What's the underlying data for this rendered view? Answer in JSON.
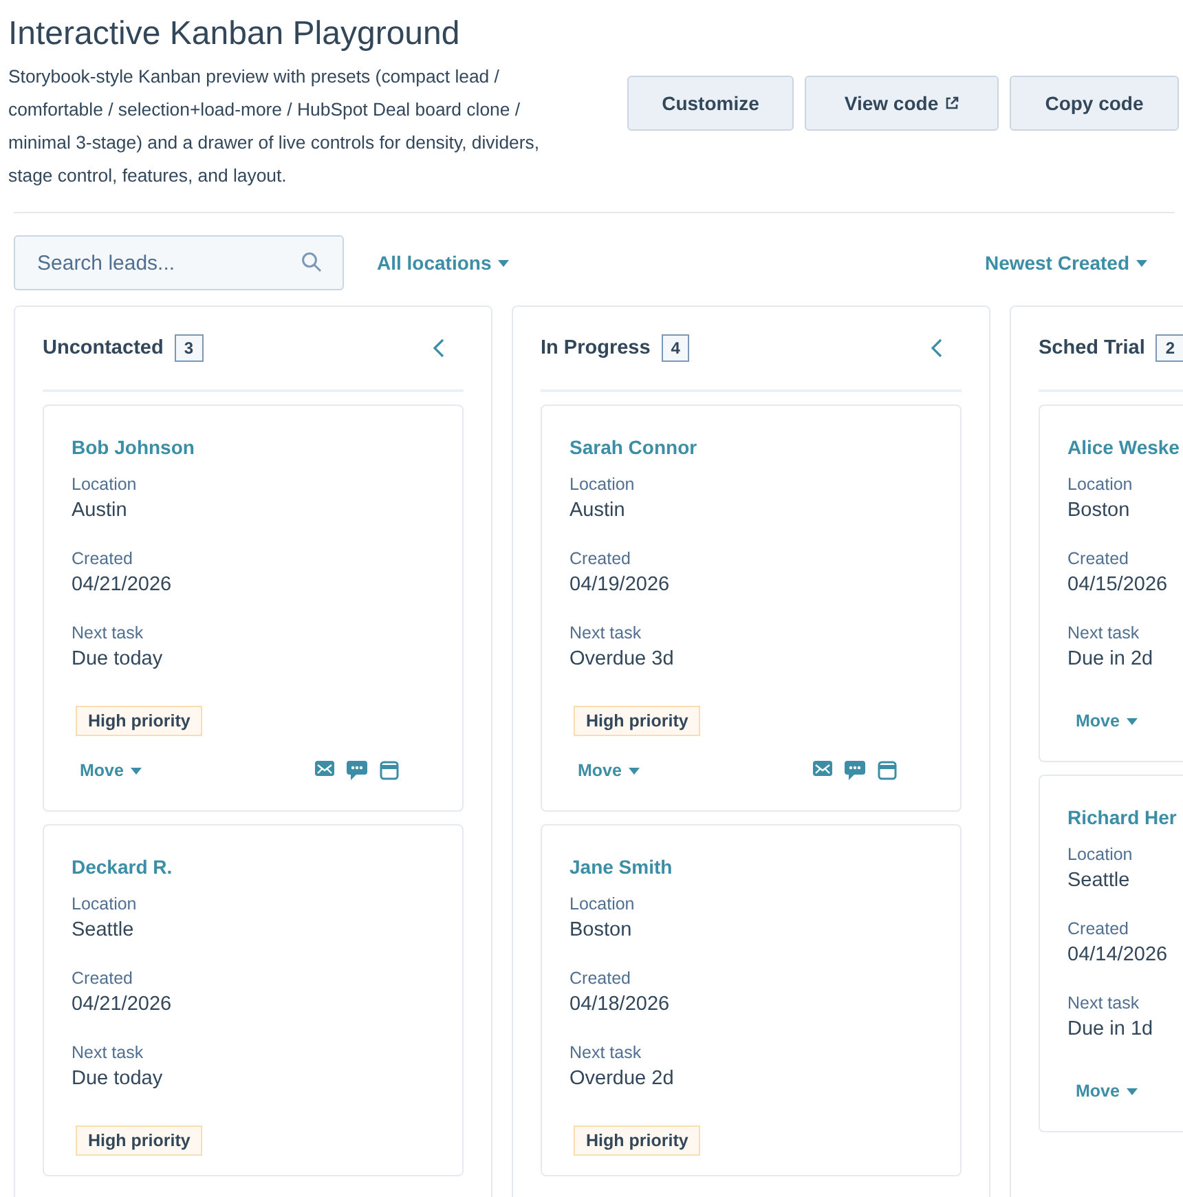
{
  "header": {
    "title": "Interactive Kanban Playground",
    "description": "Storybook-style Kanban preview with presets (compact lead / comfortable / selection+load-more / HubSpot Deal board clone / minimal 3-stage) and a drawer of live controls for density, dividers, stage control, features, and layout.",
    "buttons": [
      {
        "label": "Customize",
        "external": false
      },
      {
        "label": "View code",
        "external": true
      },
      {
        "label": "Copy code",
        "external": false
      }
    ]
  },
  "toolbar": {
    "search": {
      "placeholder": "Search leads..."
    },
    "location_filter": "All locations",
    "sort": "Newest Created"
  },
  "columns": [
    {
      "title": "Uncontacted",
      "count": "3",
      "cards": [
        {
          "name": "Bob Johnson",
          "fields": [
            {
              "label": "Location",
              "value": "Austin"
            },
            {
              "label": "Created",
              "value": "04/21/2026"
            },
            {
              "label": "Next task",
              "value": "Due today"
            }
          ],
          "tag": "High priority",
          "move": "Move",
          "actions": true
        },
        {
          "name": "Deckard R.",
          "fields": [
            {
              "label": "Location",
              "value": "Seattle"
            },
            {
              "label": "Created",
              "value": "04/21/2026"
            },
            {
              "label": "Next task",
              "value": "Due today"
            }
          ],
          "tag": "High priority"
        }
      ]
    },
    {
      "title": "In Progress",
      "count": "4",
      "cards": [
        {
          "name": "Sarah Connor",
          "fields": [
            {
              "label": "Location",
              "value": "Austin"
            },
            {
              "label": "Created",
              "value": "04/19/2026"
            },
            {
              "label": "Next task",
              "value": "Overdue 3d"
            }
          ],
          "tag": "High priority",
          "move": "Move",
          "actions": true
        },
        {
          "name": "Jane Smith",
          "fields": [
            {
              "label": "Location",
              "value": "Boston"
            },
            {
              "label": "Created",
              "value": "04/18/2026"
            },
            {
              "label": "Next task",
              "value": "Overdue 2d"
            }
          ],
          "tag": "High priority"
        }
      ]
    },
    {
      "title": "Sched Trial",
      "count": "2",
      "cards": [
        {
          "name": "Alice Weske",
          "fields": [
            {
              "label": "Location",
              "value": "Boston"
            },
            {
              "label": "Created",
              "value": "04/15/2026"
            },
            {
              "label": "Next task",
              "value": "Due in 2d"
            }
          ],
          "move": "Move",
          "actions": false
        },
        {
          "name": "Richard Her",
          "fields": [
            {
              "label": "Location",
              "value": "Seattle"
            },
            {
              "label": "Created",
              "value": "04/14/2026"
            },
            {
              "label": "Next task",
              "value": "Due in 1d"
            }
          ],
          "move": "Move",
          "actions": false
        }
      ]
    }
  ]
}
